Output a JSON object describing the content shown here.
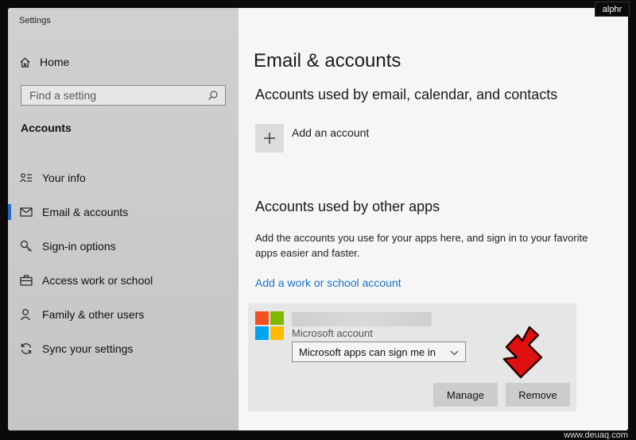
{
  "window": {
    "title": "Settings"
  },
  "sidebar": {
    "home": "Home",
    "search_placeholder": "Find a setting",
    "section": "Accounts",
    "items": [
      {
        "label": "Your info",
        "icon": "person-card-icon"
      },
      {
        "label": "Email & accounts",
        "icon": "mail-icon",
        "active": true
      },
      {
        "label": "Sign-in options",
        "icon": "key-icon"
      },
      {
        "label": "Access work or school",
        "icon": "briefcase-icon"
      },
      {
        "label": "Family & other users",
        "icon": "person-icon"
      },
      {
        "label": "Sync your settings",
        "icon": "sync-icon"
      }
    ]
  },
  "main": {
    "title": "Email & accounts",
    "email_heading": "Accounts used by email, calendar, and contacts",
    "add_account": "Add an account",
    "other_heading": "Accounts used by other apps",
    "other_desc": "Add the accounts you use for your apps here, and sign in to your favorite apps easier and faster.",
    "add_work_link": "Add a work or school account",
    "account": {
      "type": "Microsoft account",
      "signin_option": "Microsoft apps can sign me in",
      "manage": "Manage",
      "remove": "Remove"
    }
  },
  "colors": {
    "accent": "#2b67c9",
    "link": "#1a72c4",
    "arrow": "#e01010",
    "ms_red": "#f25022",
    "ms_green": "#7fba00",
    "ms_blue": "#00a4ef",
    "ms_yellow": "#ffb900"
  },
  "overlay": {
    "watermark": "alphr",
    "credit": "www.deuaq.com"
  }
}
